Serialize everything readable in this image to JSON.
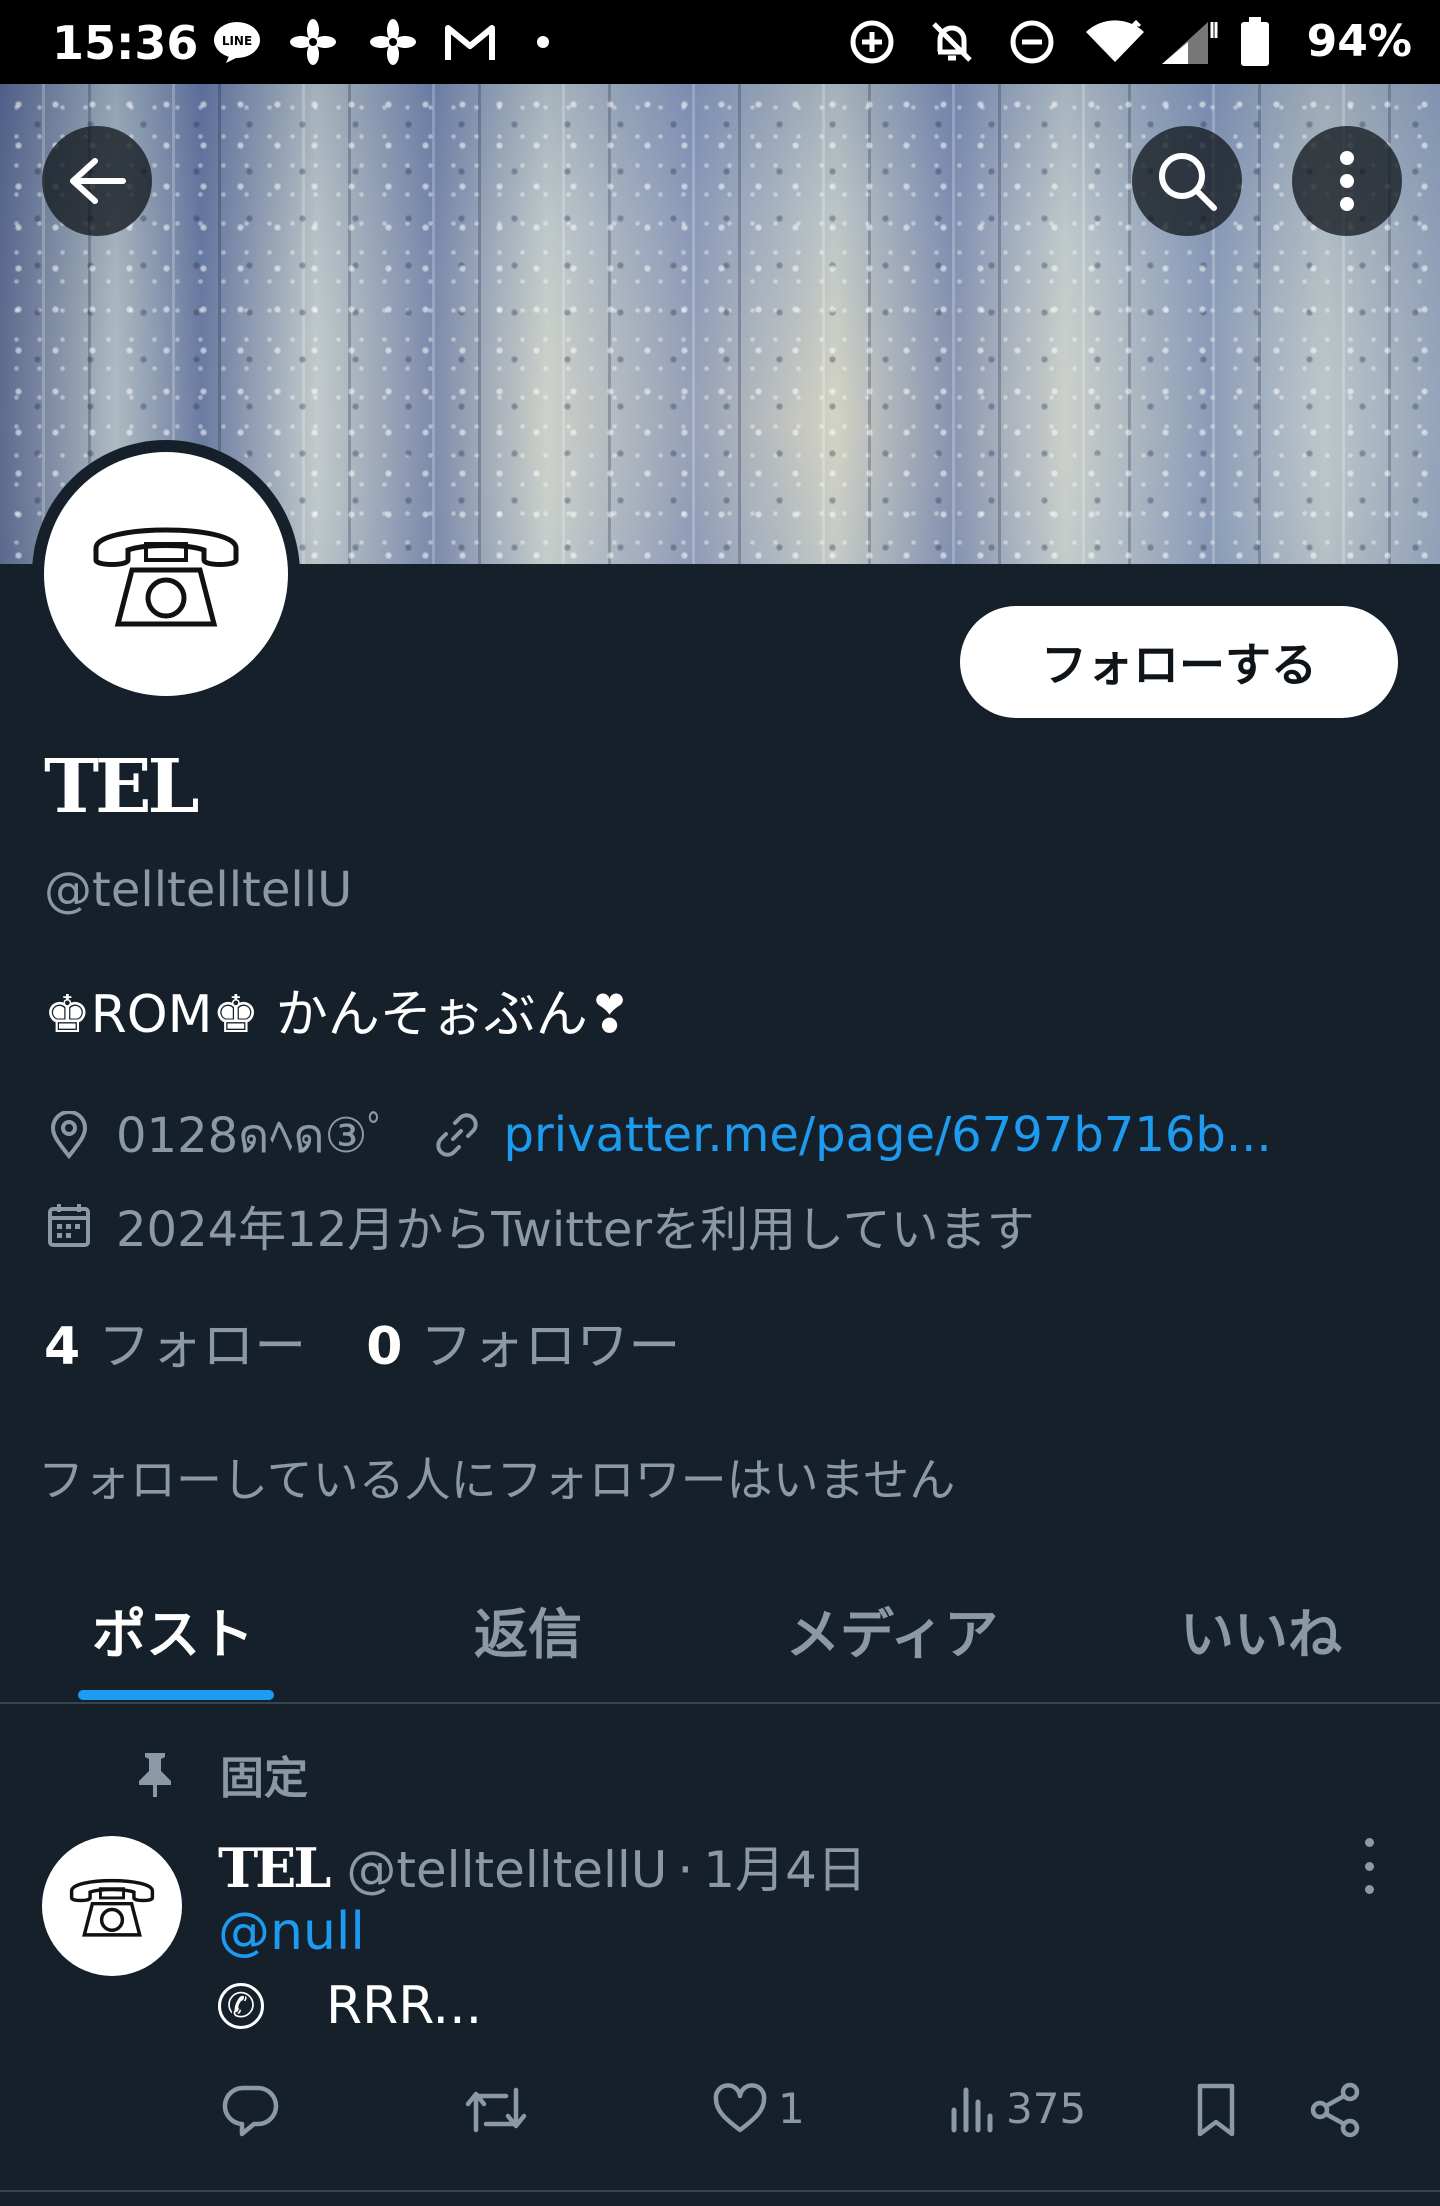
{
  "status_bar": {
    "time": "15:36",
    "battery": "94%",
    "icons": [
      "line-icon",
      "pinwheel-icon",
      "pinwheel-icon",
      "gmail-icon",
      "dot-icon",
      "data-saver-icon",
      "bell-off-icon",
      "dnd-icon",
      "wifi-icon",
      "signal-icon",
      "battery-icon"
    ]
  },
  "header": {
    "back_icon": "arrow-left-icon",
    "search_icon": "search-icon",
    "more_icon": "more-vertical-icon"
  },
  "profile": {
    "name": "TEL",
    "handle": "@telltelltellU",
    "follow_button": "フォローする",
    "bio": "♚ROM♚ かんそぉぶん❣",
    "location": "0128ดﾍด③ﾟ",
    "link": "privatter.me/page/6797b716b...",
    "joined": "2024年12月からTwitterを利用しています",
    "following_count": "4",
    "following_label": "フォロー",
    "followers_count": "0",
    "followers_label": "フォロワー",
    "no_followers_note": "フォローしている人にフォロワーはいません"
  },
  "tabs": [
    {
      "label": "ポスト",
      "active": true
    },
    {
      "label": "返信",
      "active": false
    },
    {
      "label": "メディア",
      "active": false
    },
    {
      "label": "いいね",
      "active": false
    }
  ],
  "tweet": {
    "pinned_label": "固定",
    "author_name": "TEL",
    "author_handle": "@telltelltellU",
    "separator": "·",
    "date": "1月4日",
    "mention": "@null",
    "body_symbol": "✆",
    "body_text": "RRR...",
    "likes": "1",
    "views": "375"
  },
  "colors": {
    "background": "#15202b",
    "accent": "#1d9bf0",
    "muted": "#8b98a5",
    "divider": "#38444d"
  }
}
